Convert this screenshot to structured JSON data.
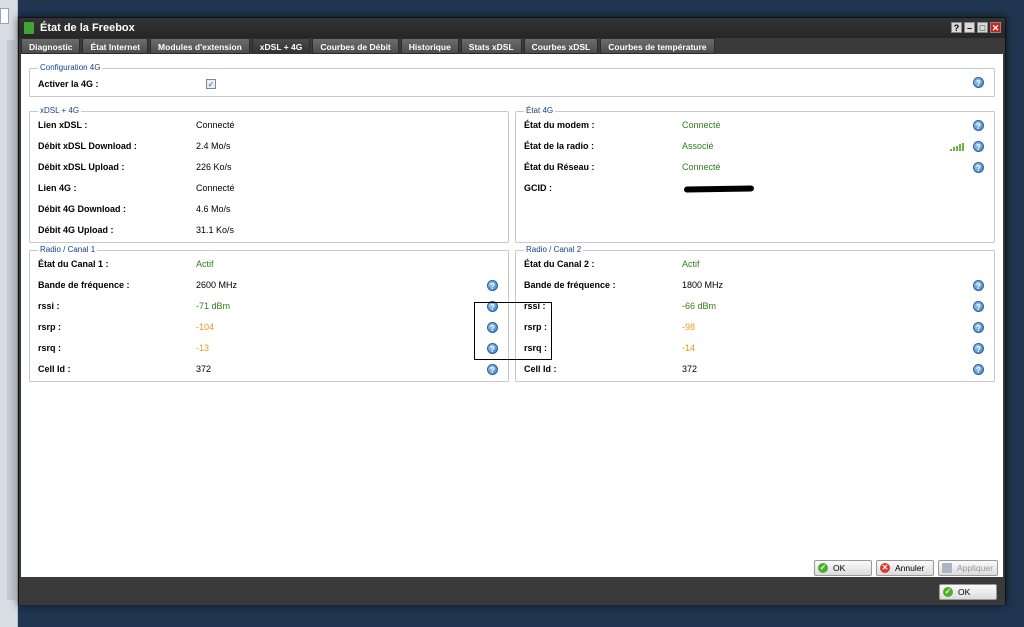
{
  "window": {
    "title": "État de la Freebox",
    "controls": {
      "help": "?",
      "minimize": "–",
      "maximize": "□",
      "close": "✕"
    }
  },
  "tabs": [
    {
      "label": "Diagnostic",
      "active": false
    },
    {
      "label": "État Internet",
      "active": false
    },
    {
      "label": "Modules d'extension",
      "active": false
    },
    {
      "label": "xDSL + 4G",
      "active": true
    },
    {
      "label": "Courbes de Débit",
      "active": false
    },
    {
      "label": "Historique",
      "active": false
    },
    {
      "label": "Stats xDSL",
      "active": false
    },
    {
      "label": "Courbes xDSL",
      "active": false
    },
    {
      "label": "Courbes de température",
      "active": false
    }
  ],
  "config4g": {
    "legend": "Configuration 4G",
    "activer_label": "Activer la 4G :",
    "activer_checked": true
  },
  "xdsl4g": {
    "legend": "xDSL + 4G",
    "rows": [
      {
        "label": "Lien xDSL :",
        "value": "Connecté"
      },
      {
        "label": "Débit xDSL Download :",
        "value": "2.4 Mo/s"
      },
      {
        "label": "Débit xDSL Upload :",
        "value": "226 Ko/s"
      },
      {
        "label": "Lien 4G :",
        "value": "Connecté"
      },
      {
        "label": "Débit 4G Download :",
        "value": "4.6 Mo/s"
      },
      {
        "label": "Débit 4G Upload :",
        "value": "31.1 Ko/s"
      }
    ]
  },
  "etat4g": {
    "legend": "État 4G",
    "rows": [
      {
        "label": "État du modem :",
        "value": "Connecté",
        "color": "#2e7d1e"
      },
      {
        "label": "État de la radio :",
        "value": "Associé",
        "color": "#2e7d1e"
      },
      {
        "label": "État du Réseau :",
        "value": "Connecté",
        "color": "#2e7d1e"
      },
      {
        "label": "GCID :",
        "value": ""
      }
    ]
  },
  "canal1": {
    "legend": "Radio / Canal 1",
    "rows": [
      {
        "label": "État du Canal 1 :",
        "value": "Actif"
      },
      {
        "label": "Bande de fréquence :",
        "value": "2600 MHz"
      },
      {
        "label": "rssi :",
        "value": "-71 dBm"
      },
      {
        "label": "rsrp :",
        "value": "-104"
      },
      {
        "label": "rsrq :",
        "value": "-13"
      },
      {
        "label": "Cell Id :",
        "value": "372"
      }
    ]
  },
  "canal2": {
    "legend": "Radio / Canal 2",
    "rows": [
      {
        "label": "État du Canal 2 :",
        "value": "Actif"
      },
      {
        "label": "Bande de fréquence :",
        "value": "1800 MHz"
      },
      {
        "label": "rssi :",
        "value": "-66 dBm"
      },
      {
        "label": "rsrp :",
        "value": "-98"
      },
      {
        "label": "rsrq :",
        "value": "-14"
      },
      {
        "label": "Cell Id :",
        "value": "372"
      }
    ]
  },
  "buttons": {
    "ok": "OK",
    "annuler": "Annuler",
    "appliquer": "Appliquer",
    "footer_ok": "OK"
  },
  "colors": {
    "green": "#2e7d1e",
    "orange": "#e69a1a",
    "accent": "#15428b"
  },
  "help_glyph": "?",
  "check_glyph": "✓"
}
